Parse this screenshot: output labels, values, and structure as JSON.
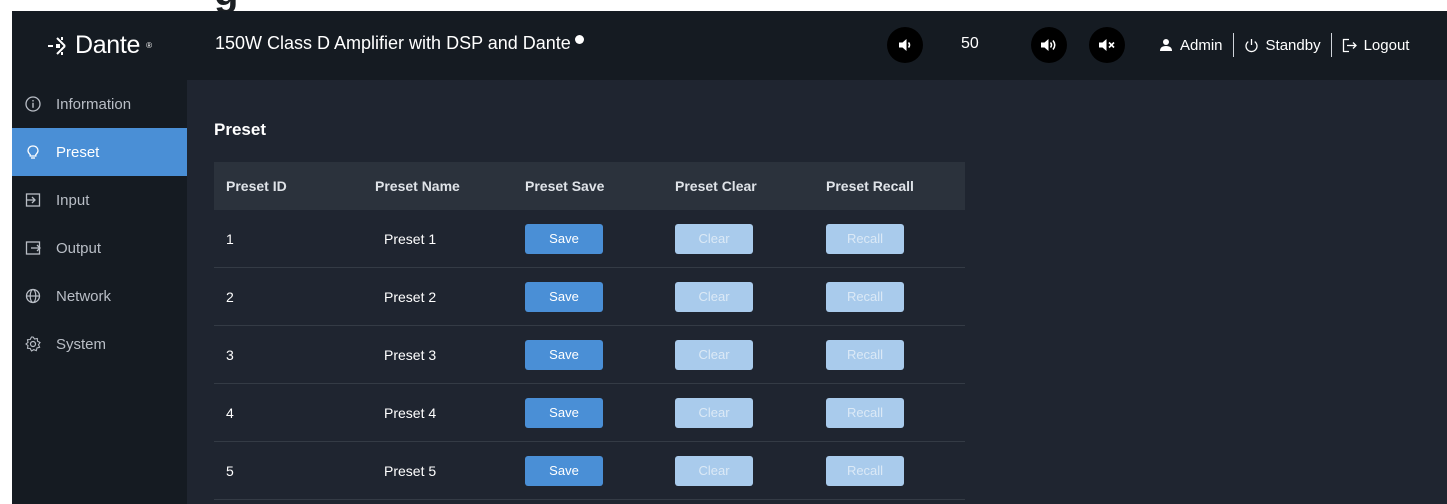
{
  "window_title_remnant": "g",
  "brand": {
    "name": "Dante",
    "reg": "®"
  },
  "header": {
    "title": "150W Class D Amplifier with DSP and Dante",
    "volume_value": "50",
    "user": "Admin",
    "standby": "Standby",
    "logout": "Logout"
  },
  "sidebar": {
    "items": [
      {
        "label": "Information",
        "icon": "info-icon",
        "active": false
      },
      {
        "label": "Preset",
        "icon": "bulb-icon",
        "active": true
      },
      {
        "label": "Input",
        "icon": "input-icon",
        "active": false
      },
      {
        "label": "Output",
        "icon": "output-icon",
        "active": false
      },
      {
        "label": "Network",
        "icon": "globe-icon",
        "active": false
      },
      {
        "label": "System",
        "icon": "gear-icon",
        "active": false
      }
    ]
  },
  "main": {
    "title": "Preset",
    "columns": [
      "Preset ID",
      "Preset Name",
      "Preset Save",
      "Preset Clear",
      "Preset Recall"
    ],
    "rows": [
      {
        "id": "1",
        "name": "Preset 1",
        "save": "Save",
        "clear": "Clear",
        "recall": "Recall"
      },
      {
        "id": "2",
        "name": "Preset 2",
        "save": "Save",
        "clear": "Clear",
        "recall": "Recall"
      },
      {
        "id": "3",
        "name": "Preset 3",
        "save": "Save",
        "clear": "Clear",
        "recall": "Recall"
      },
      {
        "id": "4",
        "name": "Preset 4",
        "save": "Save",
        "clear": "Clear",
        "recall": "Recall"
      },
      {
        "id": "5",
        "name": "Preset 5",
        "save": "Save",
        "clear": "Clear",
        "recall": "Recall"
      }
    ]
  },
  "colors": {
    "accent": "#4a8fd6",
    "sidebar_bg": "#151b22",
    "main_bg": "#1f2530",
    "disabled_button": "#a9cbec"
  }
}
